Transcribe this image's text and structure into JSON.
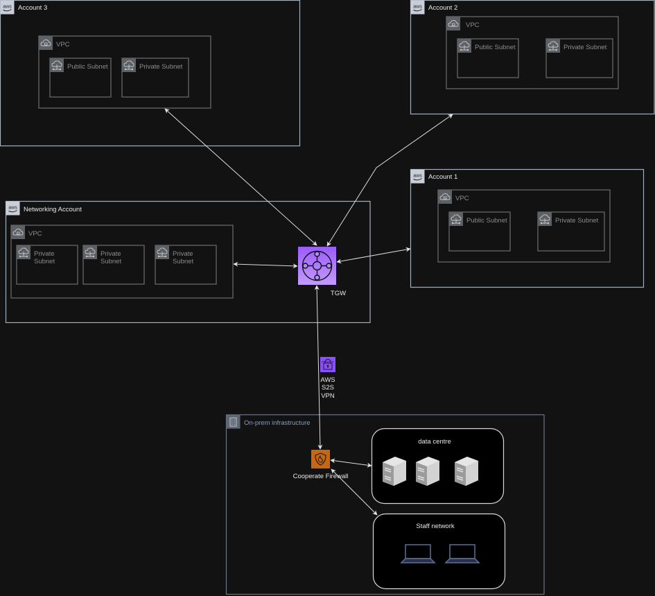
{
  "diagram": {
    "accounts": [
      {
        "label": "Account 3",
        "vpc": "VPC",
        "subnets": [
          "Public Subnet",
          "Private Subnet"
        ]
      },
      {
        "label": "Account 2",
        "vpc": "VPC",
        "subnets": [
          "Public Subnet",
          "Private Subnet"
        ]
      },
      {
        "label": "Account 1",
        "vpc": "VPC",
        "subnets": [
          "Public Subnet",
          "Private Subnet"
        ]
      }
    ],
    "networking": {
      "label": "Networking Account",
      "vpc": "VPC",
      "subnets": [
        {
          "line1": "Private",
          "line2": "Subnet"
        },
        {
          "line1": "Private",
          "line2": "Subnet"
        },
        {
          "line1": "Private",
          "line2": "Subnet"
        }
      ]
    },
    "tgw": {
      "label": "TGW",
      "color": "#a166ff"
    },
    "vpn": {
      "line1": "AWS",
      "line2": "S2S",
      "line3": "VPN",
      "color": "#8c4fff"
    },
    "onprem": {
      "label": "On-prem infrastructure",
      "firewall": {
        "label": "Cooperate Firewall",
        "color": "#c7670f"
      },
      "data_centre": {
        "label": "data centre"
      },
      "staff_network": {
        "label": "Staff network"
      }
    },
    "colors": {
      "background": "#121212",
      "account_border": "#a7aebb",
      "vpc_border": "#6e6e6e"
    }
  }
}
